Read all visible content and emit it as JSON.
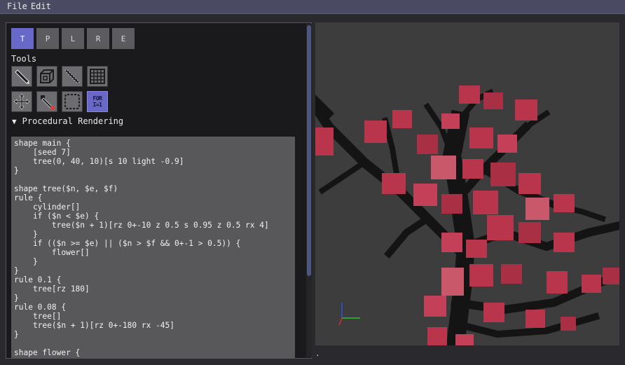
{
  "menu": {
    "file": "File",
    "edit": "Edit"
  },
  "tabs": [
    {
      "label": "T",
      "active": true
    },
    {
      "label": "P",
      "active": false
    },
    {
      "label": "L",
      "active": false
    },
    {
      "label": "R",
      "active": false
    },
    {
      "label": "E",
      "active": false
    }
  ],
  "tools": {
    "label": "Tools",
    "items": [
      {
        "icon": "pencil-icon"
      },
      {
        "icon": "cube-icon"
      },
      {
        "icon": "line-icon"
      },
      {
        "icon": "grid-icon"
      },
      {
        "icon": "move-icon"
      },
      {
        "icon": "eyedropper-icon"
      },
      {
        "icon": "selection-icon"
      },
      {
        "icon": "procedural-icon",
        "text_line1": "FOR",
        "text_line2": "I=1",
        "active": true
      }
    ]
  },
  "section": {
    "title": "Procedural Rendering",
    "expanded": true
  },
  "code": "shape main {\n    [seed 7]\n    tree(0, 40, 10)[s 10 light -0.9]\n}\n\nshape tree($n, $e, $f)\nrule {\n    cylinder[]\n    if ($n < $e) {\n        tree($n + 1)[rz 0+-10 z 0.5 s 0.95 z 0.5 rx 4]\n    }\n    if (($n >= $e) || ($n > $f && 0+-1 > 0.5)) {\n        flower[]\n    }\n}\nrule 0.1 {\n    tree[rz 180]\n}\nrule 0.08 {\n    tree[]\n    tree($n + 1)[rz 0+-180 rx -45]\n}\n\nshape flower {",
  "viewport": {
    "background": "#3d3d3d",
    "branch_color": "#141414",
    "flower_color": "#b8354b",
    "axis_colors": {
      "x": "#d23030",
      "y": "#30c030",
      "z": "#3050e0"
    }
  },
  "status": "."
}
